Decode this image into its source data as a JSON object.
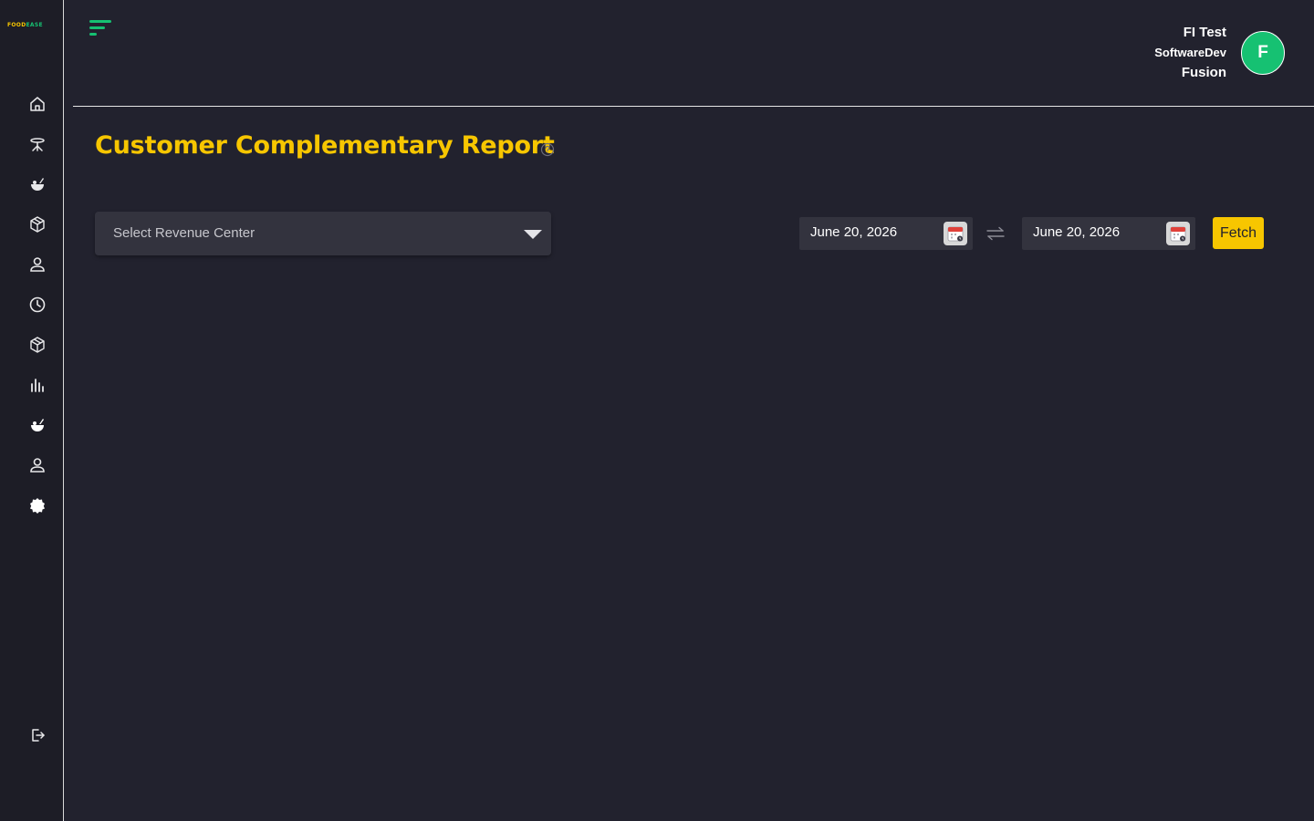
{
  "brand": {
    "logo_part1": "FOOD",
    "logo_part2": "EASE"
  },
  "sidebar": {
    "items": [
      {
        "icon": "home-icon"
      },
      {
        "icon": "dining-table-icon"
      },
      {
        "icon": "food-bowl-icon"
      },
      {
        "icon": "box-icon"
      },
      {
        "icon": "user-icon"
      },
      {
        "icon": "clock-icon"
      },
      {
        "icon": "box-icon"
      },
      {
        "icon": "bar-chart-icon"
      },
      {
        "icon": "food-bowl-icon"
      },
      {
        "icon": "user-icon"
      },
      {
        "icon": "settings-icon"
      }
    ],
    "logout_icon": "logout-icon"
  },
  "header": {
    "user_name": "FI Test",
    "user_org": "SoftwareDev",
    "user_sub": "Fusion",
    "avatar_initial": "F"
  },
  "page": {
    "title": "Customer Complementary Report"
  },
  "filters": {
    "revenue_center_placeholder": "Select Revenue Center",
    "start_date": "June 20, 2026",
    "end_date": "June 20, 2026",
    "fetch_label": "Fetch"
  },
  "colors": {
    "accent_yellow": "#f7c600",
    "accent_green": "#16c172",
    "background": "#22222e",
    "sidebar": "#1d1d26"
  }
}
